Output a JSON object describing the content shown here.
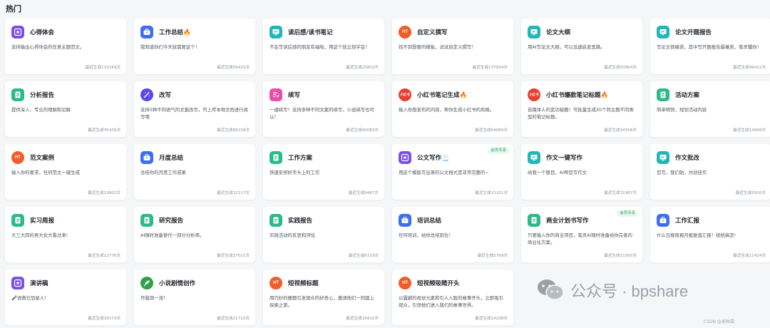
{
  "section_title": "热门",
  "cards": [
    {
      "title": "心得体会",
      "desc": "支持输出心得体会的任意主题范文。",
      "count": "最近生成115169次",
      "icon": "star-badge-icon",
      "color": "#7a4fe6",
      "shape": "square"
    },
    {
      "title": "工作总结🔥",
      "desc": "我知道你们今天就需要这个！",
      "count": "最近生成56425次",
      "icon": "briefcase-icon",
      "color": "#3d6ef0",
      "shape": "square"
    },
    {
      "title": "读后感/读书笔记",
      "desc": "不会写读后感的朋友有福啦，用这个就立刻学会！",
      "count": "最近生成25802次",
      "icon": "monitor-icon",
      "color": "#23b6b9",
      "shape": "square"
    },
    {
      "title": "自定义撰写",
      "desc": "找不到想要的模板，试试自定义撰写！",
      "count": "最近生成137934次",
      "icon": "flame-icon",
      "color": "#f25c2a",
      "shape": "round",
      "label": "HT"
    },
    {
      "title": "论文大纲",
      "desc": "用AI写论文大纲，可以迅速启发思路。",
      "count": "最近生成50964次",
      "icon": "monitor-icon",
      "color": "#23b6b9",
      "shape": "square"
    },
    {
      "title": "论文开题报告",
      "desc": "写论文很痛苦，其中写开题报告最痛苦，笔灵懂你！",
      "count": "最近生成46422次",
      "icon": "monitor-icon",
      "color": "#23b6b9",
      "shape": "square"
    },
    {
      "title": "分析报告",
      "desc": "提供深入、专业的理解和见解",
      "count": "最近生成35439次",
      "icon": "document-icon",
      "color": "#2cb98b",
      "shape": "square"
    },
    {
      "title": "改写",
      "desc": "支持5种不同语气的文案改写，可上传本地文档进行改写哦",
      "count": "最近生成89239次",
      "icon": "magic-wand-icon",
      "color": "#5a49e8",
      "shape": "round"
    },
    {
      "title": "续写",
      "desc": "一键续写！支持多种不同文案的续写，小说续写也可以！",
      "count": "最近生成40083次",
      "icon": "edit-lines-icon",
      "color": "#e94fa8",
      "shape": "square"
    },
    {
      "title": "小红书笔记生成🔥",
      "desc": "输入你想发布的内容，帮你生成小红书的风格。",
      "count": "最近生成54065次",
      "icon": "xiaohongshu-icon",
      "color": "#e8402f",
      "shape": "round",
      "label": "小红书"
    },
    {
      "title": "小红书爆款笔记标题🔥",
      "desc": "自媒体人的武功秘籍！可批量生成20个同主题不同类型的笔记标题。",
      "count": "最近生成34358次",
      "icon": "xiaohongshu-icon",
      "color": "#e8402f",
      "shape": "round",
      "label": "小红书"
    },
    {
      "title": "活动方案",
      "desc": "简单明快，规划活动内容",
      "count": "最近生成14906次",
      "icon": "document-icon",
      "color": "#2cb98b",
      "shape": "square"
    },
    {
      "title": "范文案例",
      "desc": "输入你的要求，任何范文一键生成",
      "count": "最近生成13802次",
      "icon": "flame-icon",
      "color": "#f25c2a",
      "shape": "round",
      "label": "HT"
    },
    {
      "title": "月度总结",
      "desc": "总结你的月度工作成果",
      "count": "最近生成12317次",
      "icon": "briefcase-icon",
      "color": "#3d6ef0",
      "shape": "square"
    },
    {
      "title": "工作方案",
      "desc": "快速安排好手头上的工作",
      "count": "最近生成9487次",
      "icon": "document-icon",
      "color": "#2cb98b",
      "shape": "square"
    },
    {
      "title": "公文写作📃",
      "desc": "用这个模版写出来的公文格式是非常完整的~",
      "count": "最近生成13201次",
      "icon": "star-badge-icon",
      "color": "#7a4fe6",
      "shape": "square",
      "badge": "会员专享"
    },
    {
      "title": "作文一键写作",
      "desc": "给我一个题目，AI帮您写作文",
      "count": "最近生成31987次",
      "icon": "monitor-icon",
      "color": "#23b6b9",
      "shape": "square"
    },
    {
      "title": "作文批改",
      "desc": "您写，我们助，共创佳作",
      "count": "最近生成5926次",
      "icon": "monitor-icon",
      "color": "#23b6b9",
      "shape": "square"
    },
    {
      "title": "实习周报",
      "desc": "大三大四的男大女大看过来!",
      "count": "最近生成12776次",
      "icon": "document-icon",
      "color": "#2cb98b",
      "shape": "square"
    },
    {
      "title": "研究报告",
      "desc": "AI随时准备替代一部分分析师。",
      "count": "最近生成17521次",
      "icon": "document-icon",
      "color": "#2cb98b",
      "shape": "square"
    },
    {
      "title": "实践报告",
      "desc": "实践活动的反思和评估",
      "count": "最近生成6133次",
      "icon": "document-icon",
      "color": "#2cb98b",
      "shape": "square"
    },
    {
      "title": "培训总结",
      "desc": "任何培训，给你总结到位！",
      "count": "最近生成5769次",
      "icon": "briefcase-icon",
      "color": "#3d6ef0",
      "shape": "square"
    },
    {
      "title": "商业计划书写作",
      "desc": "只要输入你的商业项目，笔灵AI随时准备给你完善的商业化方案。",
      "count": "最近生成11050次",
      "icon": "document-icon",
      "color": "#2cb98b",
      "shape": "square",
      "badge": "会员专享"
    },
    {
      "title": "工作汇报",
      "desc": "什么日报周报月报复盘汇报！统统搞定!",
      "count": "最近生成11424次",
      "icon": "briefcase-icon",
      "color": "#3d6ef0",
      "shape": "square"
    },
    {
      "title": "演讲稿",
      "desc": "🎤语救社恐星人！",
      "count": "最近生成18274次",
      "icon": "star-badge-icon",
      "color": "#7a4fe6",
      "shape": "square"
    },
    {
      "title": "小说剧情创作",
      "desc": "开脑洞一流！",
      "count": "最近生成21710次",
      "icon": "feather-icon",
      "color": "#2ea14a",
      "shape": "round"
    },
    {
      "title": "短视频标题",
      "desc": "用巧妙的梗题引发观众的好奇心，邀请他们一同踏上探索之旅。",
      "count": "最近生成16910次",
      "icon": "flame-icon",
      "color": "#f25c2a",
      "shape": "round",
      "label": "HT"
    },
    {
      "title": "短视频吸睛开头",
      "desc": "以震撼的视觉元素和引人入胜的故事开头，立即吸引观众，引领他们进入我们的故事世界。",
      "count": "最近生成14208次",
      "icon": "flame-icon",
      "color": "#f25c2a",
      "shape": "round",
      "label": "HT"
    }
  ],
  "watermark": {
    "text": "公众号 · bpshare",
    "icon": "wechat-icon"
  },
  "footnote": "CSDN @吴秋霖"
}
